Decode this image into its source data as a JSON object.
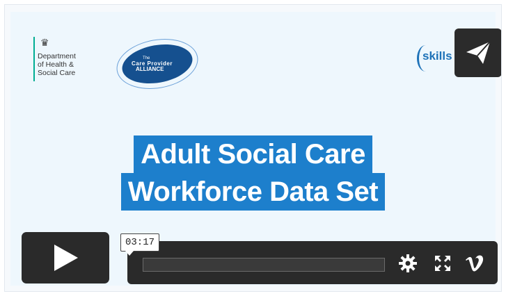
{
  "logos": {
    "dhsc": {
      "lines": [
        "Department",
        "of Health &",
        "Social Care"
      ]
    },
    "care_provider_alliance": {
      "small": "The",
      "name": "Care Provider",
      "big": "ALLIANCE"
    },
    "skills": {
      "text": "skills"
    }
  },
  "title": {
    "line1": "Adult Social Care",
    "line2": "Workforce Data Set"
  },
  "player": {
    "time": "03:17",
    "progress": 0.0
  },
  "icons": {
    "share": "paper-plane-icon",
    "play": "play-icon",
    "settings": "gear-icon",
    "fullscreen": "fullscreen-icon",
    "brand": "vimeo-icon"
  },
  "colors": {
    "title_bg": "#1d7fcc",
    "control_bg": "#2a2a2a"
  }
}
